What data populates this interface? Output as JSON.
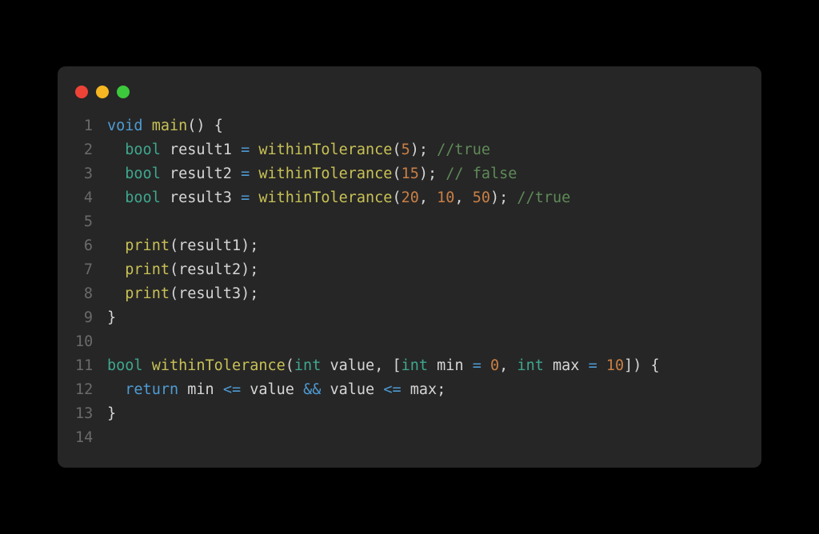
{
  "colors": {
    "bg": "#000",
    "panel": "#262626",
    "red": "#ed4337",
    "yellow": "#f5b621",
    "green": "#3cc93c",
    "gutter": "#6a6a6a",
    "keyword": "#4e9bd4",
    "type": "#3fa78e",
    "func": "#c8c156",
    "ident": "#d6d6d6",
    "num": "#c97f45",
    "comment": "#5f8a58"
  },
  "lines": [
    {
      "n": "1",
      "tokens": [
        [
          "keyword",
          "void"
        ],
        [
          "punct",
          " "
        ],
        [
          "func",
          "main"
        ],
        [
          "punct",
          "() "
        ],
        [
          "brace",
          "{"
        ]
      ]
    },
    {
      "n": "2",
      "tokens": [
        [
          "punct",
          "  "
        ],
        [
          "type",
          "bool"
        ],
        [
          "punct",
          " "
        ],
        [
          "ident",
          "result1"
        ],
        [
          "punct",
          " "
        ],
        [
          "op",
          "="
        ],
        [
          "punct",
          " "
        ],
        [
          "func",
          "withinTolerance"
        ],
        [
          "punct",
          "("
        ],
        [
          "num",
          "5"
        ],
        [
          "punct",
          "); "
        ],
        [
          "comment",
          "//true"
        ]
      ]
    },
    {
      "n": "3",
      "tokens": [
        [
          "punct",
          "  "
        ],
        [
          "type",
          "bool"
        ],
        [
          "punct",
          " "
        ],
        [
          "ident",
          "result2"
        ],
        [
          "punct",
          " "
        ],
        [
          "op",
          "="
        ],
        [
          "punct",
          " "
        ],
        [
          "func",
          "withinTolerance"
        ],
        [
          "punct",
          "("
        ],
        [
          "num",
          "15"
        ],
        [
          "punct",
          "); "
        ],
        [
          "comment",
          "// false"
        ]
      ]
    },
    {
      "n": "4",
      "tokens": [
        [
          "punct",
          "  "
        ],
        [
          "type",
          "bool"
        ],
        [
          "punct",
          " "
        ],
        [
          "ident",
          "result3"
        ],
        [
          "punct",
          " "
        ],
        [
          "op",
          "="
        ],
        [
          "punct",
          " "
        ],
        [
          "func",
          "withinTolerance"
        ],
        [
          "punct",
          "("
        ],
        [
          "num",
          "20"
        ],
        [
          "punct",
          ", "
        ],
        [
          "num",
          "10"
        ],
        [
          "punct",
          ", "
        ],
        [
          "num",
          "50"
        ],
        [
          "punct",
          "); "
        ],
        [
          "comment",
          "//true"
        ]
      ]
    },
    {
      "n": "5",
      "tokens": [
        [
          "punct",
          ""
        ]
      ]
    },
    {
      "n": "6",
      "tokens": [
        [
          "punct",
          "  "
        ],
        [
          "func",
          "print"
        ],
        [
          "punct",
          "("
        ],
        [
          "ident",
          "result1"
        ],
        [
          "punct",
          ");"
        ]
      ]
    },
    {
      "n": "7",
      "tokens": [
        [
          "punct",
          "  "
        ],
        [
          "func",
          "print"
        ],
        [
          "punct",
          "("
        ],
        [
          "ident",
          "result2"
        ],
        [
          "punct",
          ");"
        ]
      ]
    },
    {
      "n": "8",
      "tokens": [
        [
          "punct",
          "  "
        ],
        [
          "func",
          "print"
        ],
        [
          "punct",
          "("
        ],
        [
          "ident",
          "result3"
        ],
        [
          "punct",
          ");"
        ]
      ]
    },
    {
      "n": "9",
      "tokens": [
        [
          "brace",
          "}"
        ]
      ]
    },
    {
      "n": "10",
      "tokens": [
        [
          "punct",
          ""
        ]
      ]
    },
    {
      "n": "11",
      "tokens": [
        [
          "type",
          "bool"
        ],
        [
          "punct",
          " "
        ],
        [
          "func",
          "withinTolerance"
        ],
        [
          "punct",
          "("
        ],
        [
          "type",
          "int"
        ],
        [
          "punct",
          " "
        ],
        [
          "ident",
          "value"
        ],
        [
          "punct",
          ", ["
        ],
        [
          "type",
          "int"
        ],
        [
          "punct",
          " "
        ],
        [
          "ident",
          "min"
        ],
        [
          "punct",
          " "
        ],
        [
          "op",
          "="
        ],
        [
          "punct",
          " "
        ],
        [
          "num",
          "0"
        ],
        [
          "punct",
          ", "
        ],
        [
          "type",
          "int"
        ],
        [
          "punct",
          " "
        ],
        [
          "ident",
          "max"
        ],
        [
          "punct",
          " "
        ],
        [
          "op",
          "="
        ],
        [
          "punct",
          " "
        ],
        [
          "num",
          "10"
        ],
        [
          "punct",
          "]) "
        ],
        [
          "brace",
          "{"
        ]
      ]
    },
    {
      "n": "12",
      "tokens": [
        [
          "punct",
          "  "
        ],
        [
          "keyword",
          "return"
        ],
        [
          "punct",
          " "
        ],
        [
          "ident",
          "min"
        ],
        [
          "punct",
          " "
        ],
        [
          "op",
          "<="
        ],
        [
          "punct",
          " "
        ],
        [
          "ident",
          "value"
        ],
        [
          "punct",
          " "
        ],
        [
          "op",
          "&&"
        ],
        [
          "punct",
          " "
        ],
        [
          "ident",
          "value"
        ],
        [
          "punct",
          " "
        ],
        [
          "op",
          "<="
        ],
        [
          "punct",
          " "
        ],
        [
          "ident",
          "max"
        ],
        [
          "punct",
          ";"
        ]
      ]
    },
    {
      "n": "13",
      "tokens": [
        [
          "brace",
          "}"
        ]
      ]
    },
    {
      "n": "14",
      "tokens": [
        [
          "punct",
          ""
        ]
      ]
    }
  ]
}
